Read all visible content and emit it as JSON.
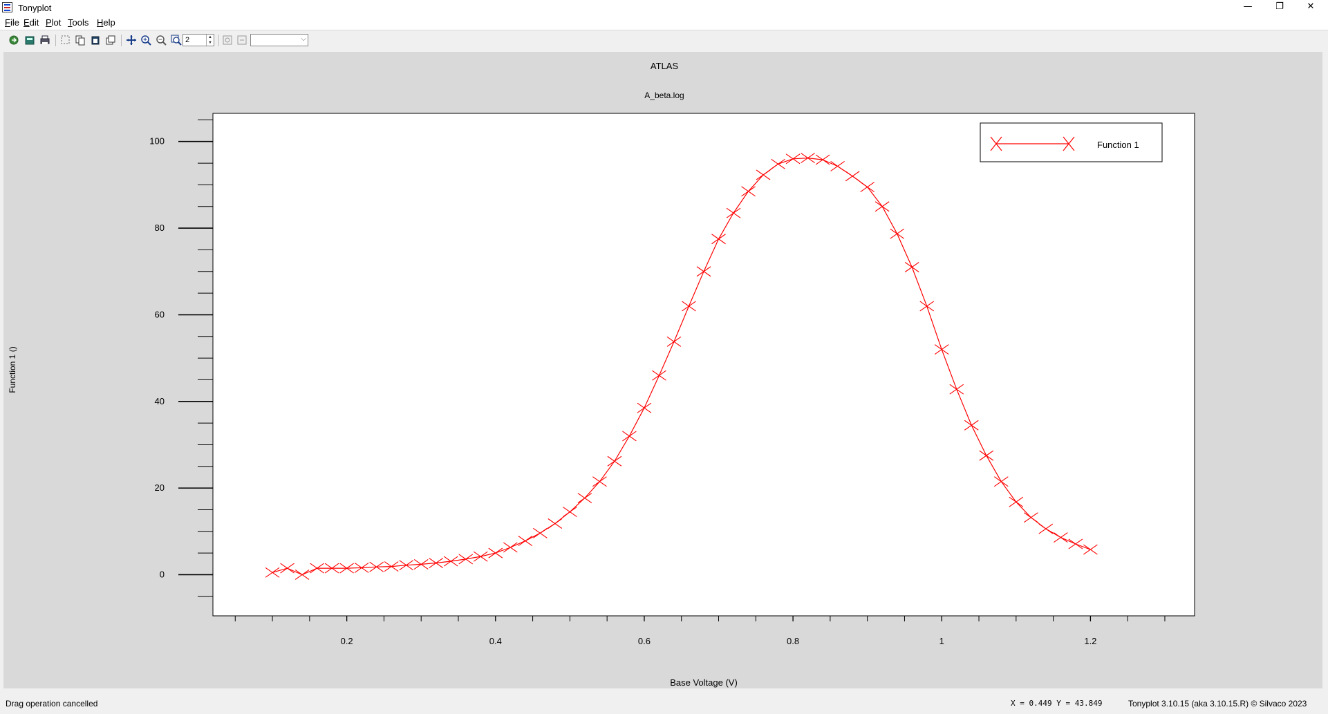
{
  "window": {
    "title": "Tonyplot",
    "minimize_glyph": "—",
    "maximize_glyph": "❐",
    "close_glyph": "✕"
  },
  "menu": {
    "items": [
      {
        "label": "File",
        "accel": "F",
        "rest": "ile"
      },
      {
        "label": "Edit",
        "accel": "E",
        "rest": "dit"
      },
      {
        "label": "Plot",
        "accel": "P",
        "rest": "lot"
      },
      {
        "label": "Tools",
        "accel": "T",
        "rest": "ools"
      },
      {
        "label": "Help",
        "accel": "H",
        "rest": "elp"
      }
    ]
  },
  "toolbar": {
    "buttons": [
      "open-icon",
      "export-icon",
      "print-icon",
      "select-icon",
      "copy-icon",
      "paste-icon",
      "overlay-icon",
      "move-icon",
      "zoom-in-icon",
      "zoom-out-icon",
      "zoom-box-icon",
      "undo-zoom-icon",
      "redo-zoom-icon"
    ],
    "spin_value": "2",
    "combo_value": ""
  },
  "plot": {
    "title": "ATLAS",
    "subtitle": "A_beta.log",
    "xlabel": "Base Voltage (V)",
    "ylabel": "Function 1 ()",
    "legend_label": "Function 1"
  },
  "chart_data": {
    "type": "line",
    "title": "ATLAS",
    "subtitle": "A_beta.log",
    "xlabel": "Base Voltage (V)",
    "ylabel": "Function 1 ()",
    "xlim": [
      0.02,
      1.34
    ],
    "ylim": [
      -9.5,
      106.5
    ],
    "xticks": [
      0.2,
      0.4,
      0.6,
      0.8,
      1,
      1.2
    ],
    "xtick_labels": [
      "0.2",
      "0.4",
      "0.6",
      "0.8",
      "1",
      "1.2"
    ],
    "yticks": [
      0,
      20,
      40,
      60,
      80,
      100
    ],
    "ytick_labels": [
      "0",
      "20",
      "40",
      "60",
      "80",
      "100"
    ],
    "legend_position": "top-right",
    "grid": false,
    "color": "#ff0000",
    "marker": "x",
    "series": [
      {
        "name": "Function 1",
        "x": [
          0.1,
          0.12,
          0.14,
          0.16,
          0.18,
          0.2,
          0.22,
          0.24,
          0.26,
          0.28,
          0.3,
          0.32,
          0.34,
          0.36,
          0.38,
          0.4,
          0.42,
          0.44,
          0.46,
          0.48,
          0.5,
          0.52,
          0.54,
          0.56,
          0.58,
          0.6,
          0.62,
          0.64,
          0.66,
          0.68,
          0.7,
          0.72,
          0.74,
          0.76,
          0.78,
          0.8,
          0.82,
          0.84,
          0.86,
          0.88,
          0.9,
          0.92,
          0.94,
          0.96,
          0.98,
          1.0,
          1.02,
          1.04,
          1.06,
          1.08,
          1.1,
          1.12,
          1.14,
          1.16,
          1.18,
          1.2
        ],
        "y": [
          0.5,
          1.5,
          0.0,
          1.5,
          1.5,
          1.5,
          1.6,
          1.8,
          1.9,
          2.2,
          2.4,
          2.7,
          3.1,
          3.6,
          4.2,
          5.0,
          6.3,
          7.8,
          9.6,
          11.8,
          14.5,
          17.7,
          21.5,
          26.2,
          32.0,
          38.5,
          46.0,
          53.8,
          62.0,
          70.0,
          77.5,
          83.5,
          88.5,
          92.3,
          94.8,
          96.0,
          96.2,
          95.8,
          94.3,
          92.0,
          89.5,
          85.0,
          78.7,
          71.0,
          62.0,
          52.0,
          42.8,
          34.5,
          27.5,
          21.5,
          16.8,
          13.2,
          10.6,
          8.6,
          7.1,
          5.8
        ]
      }
    ]
  },
  "status": {
    "message": "Drag operation cancelled",
    "coords": "X = 0.449 Y = 43.849",
    "version": "Tonyplot 3.10.15 (aka 3.10.15.R) © Silvaco 2023"
  }
}
